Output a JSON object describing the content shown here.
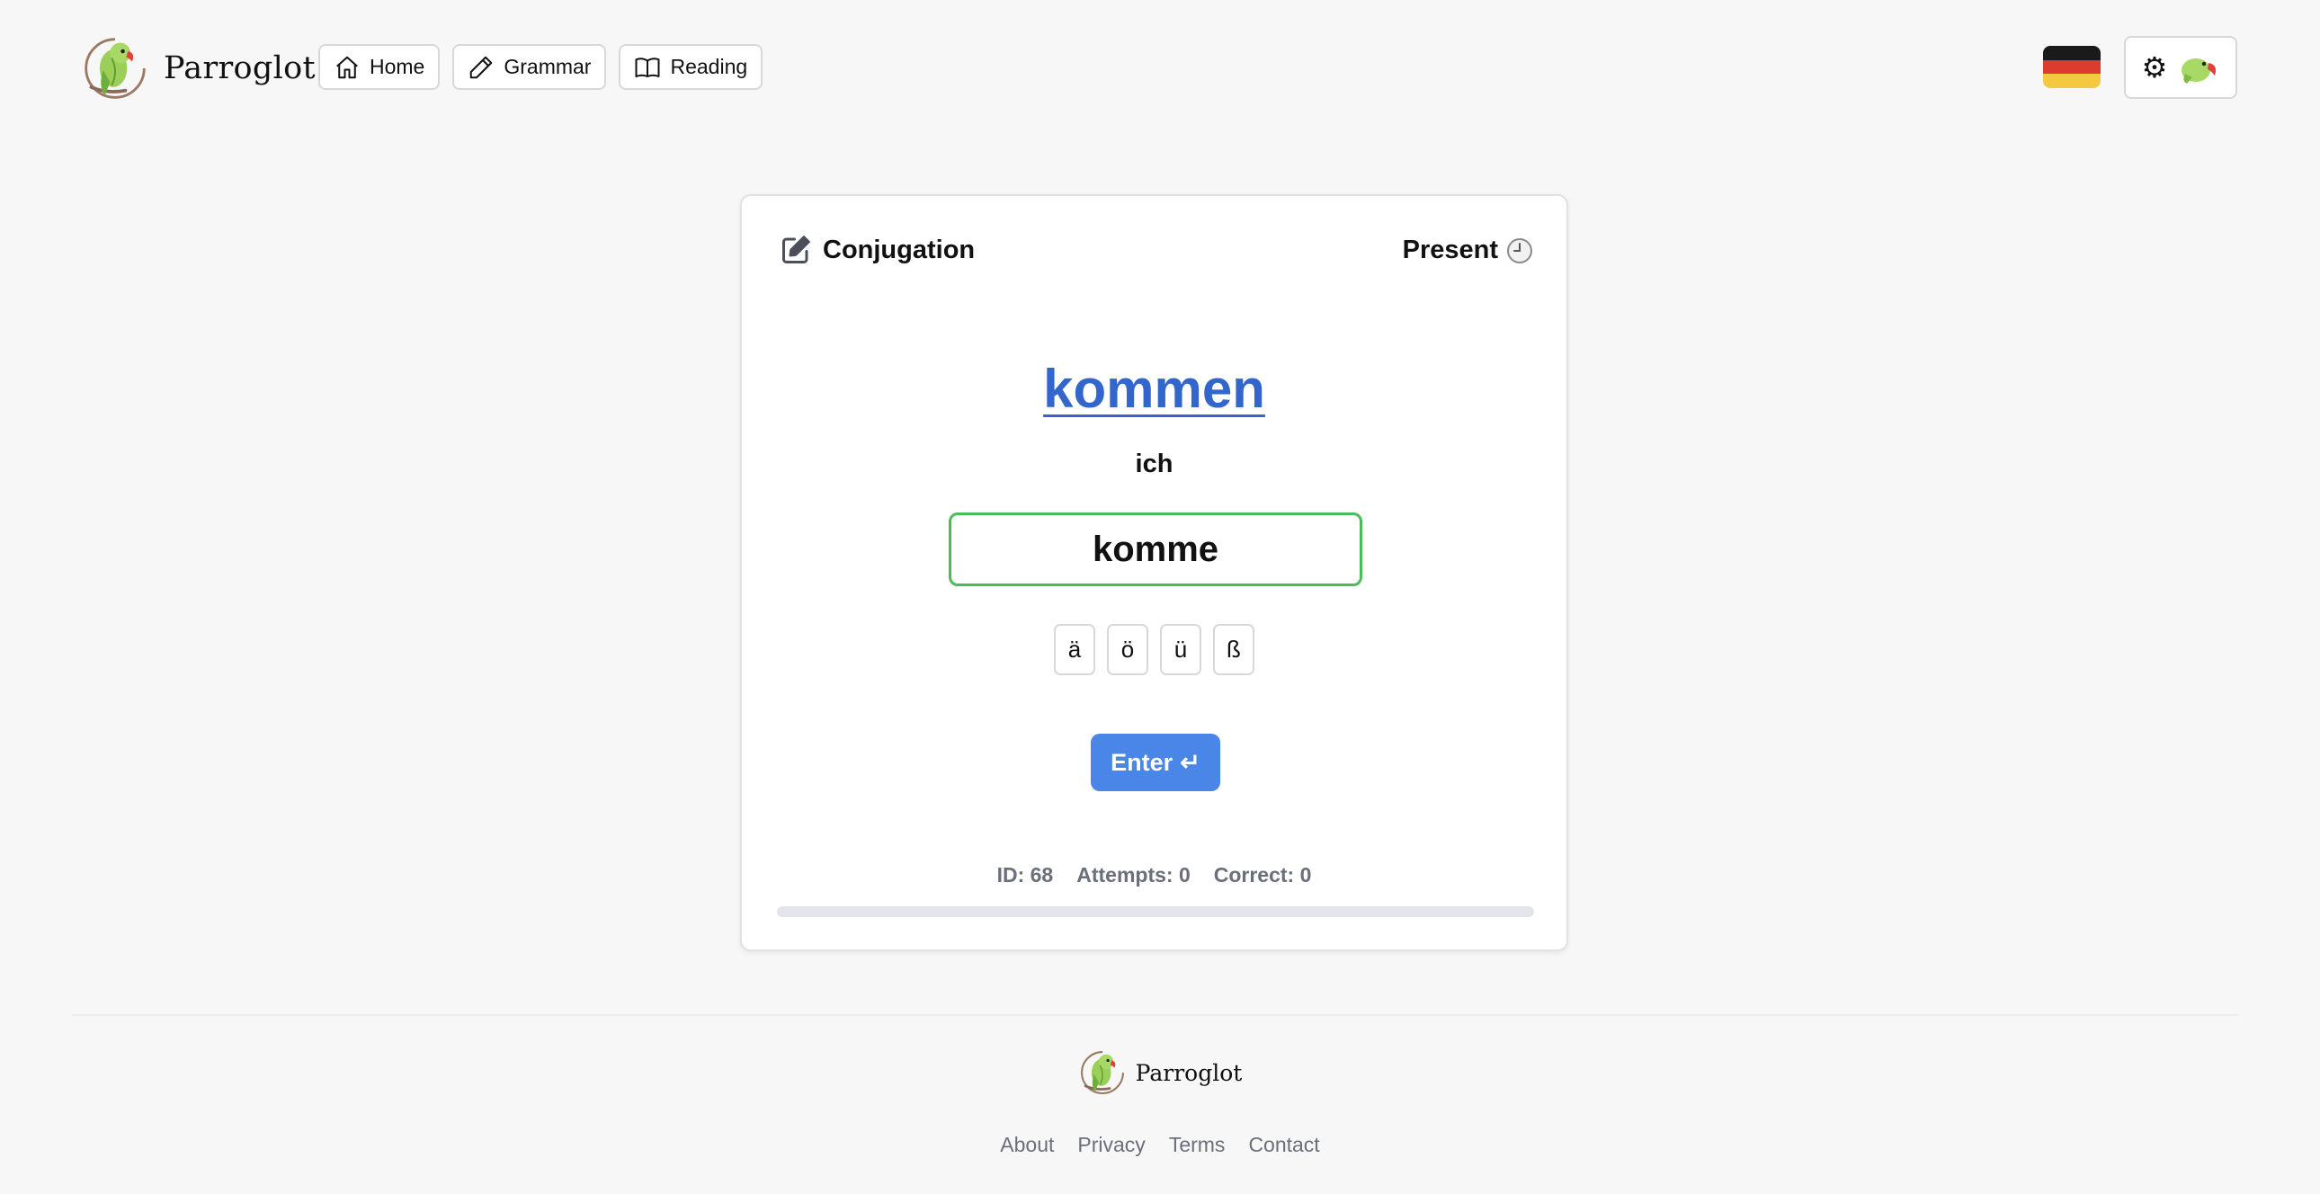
{
  "header": {
    "brand_name": "Parroglot",
    "nav": [
      {
        "label": "Home",
        "icon": "home-icon"
      },
      {
        "label": "Grammar",
        "icon": "pencil-icon"
      },
      {
        "label": "Reading",
        "icon": "book-open-icon"
      }
    ],
    "language_flag": "flag-germany-icon",
    "flag_colors": [
      "#1a1a1a",
      "#dd3b2e",
      "#f5c842"
    ],
    "settings_icons": [
      "gear-icon",
      "parrot-avatar-icon"
    ]
  },
  "card": {
    "mode_icon": "edit-square-icon",
    "mode_label": "Conjugation",
    "tense_label": "Present",
    "tense_icon": "clock-icon",
    "verb": "kommen",
    "pronoun": "ich",
    "answer_value": "komme",
    "special_chars": [
      "ä",
      "ö",
      "ü",
      "ß"
    ],
    "enter_label": "Enter",
    "enter_icon": "↵",
    "stats": {
      "id": "ID: 68",
      "attempts": "Attempts: 0",
      "correct": "Correct: 0"
    },
    "progress": 0,
    "colors": {
      "accent": "#4a86e8",
      "verb_link": "#3366cc",
      "correct_border": "#4cbb5a"
    }
  },
  "footer": {
    "brand_name": "Parroglot",
    "links": [
      "About",
      "Privacy",
      "Terms",
      "Contact"
    ]
  }
}
